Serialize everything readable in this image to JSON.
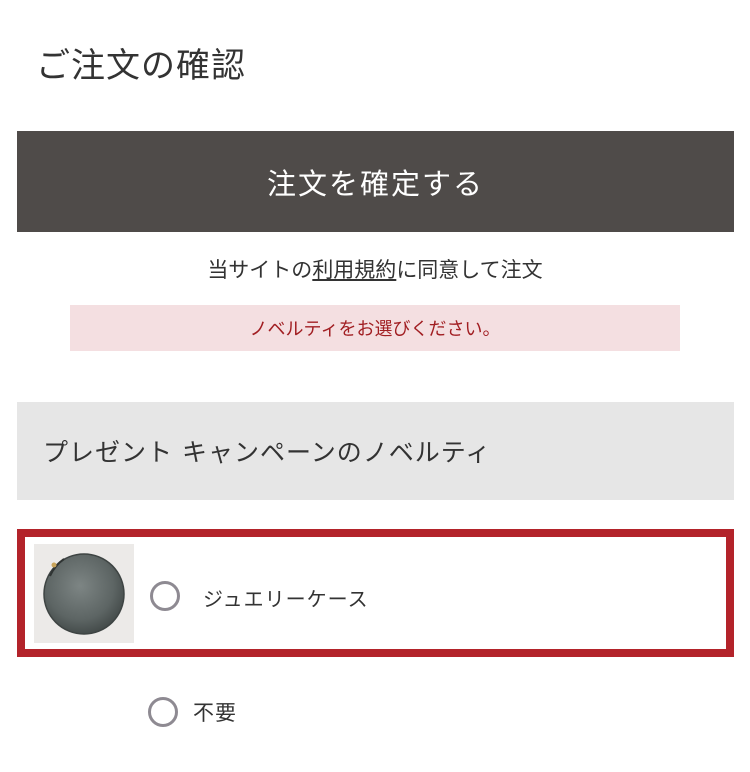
{
  "page": {
    "title": "ご注文の確認"
  },
  "confirm": {
    "button_label": "注文を確定する",
    "button_color": "#4f4b49"
  },
  "agreement": {
    "prefix": "当サイトの",
    "terms_link": "利用規約",
    "suffix": "に同意して注文"
  },
  "alert": {
    "message": "ノベルティをお選びください。",
    "text_color": "#a11e22",
    "background": "#f4dfe1"
  },
  "novelty_section": {
    "header": "プレゼント キャンペーンのノベルティ",
    "options": [
      {
        "label": "ジュエリーケース",
        "selected": false,
        "image": "jewelry-case-image",
        "highlight_color": "#b3232a"
      },
      {
        "label": "不要",
        "selected": false
      }
    ]
  }
}
